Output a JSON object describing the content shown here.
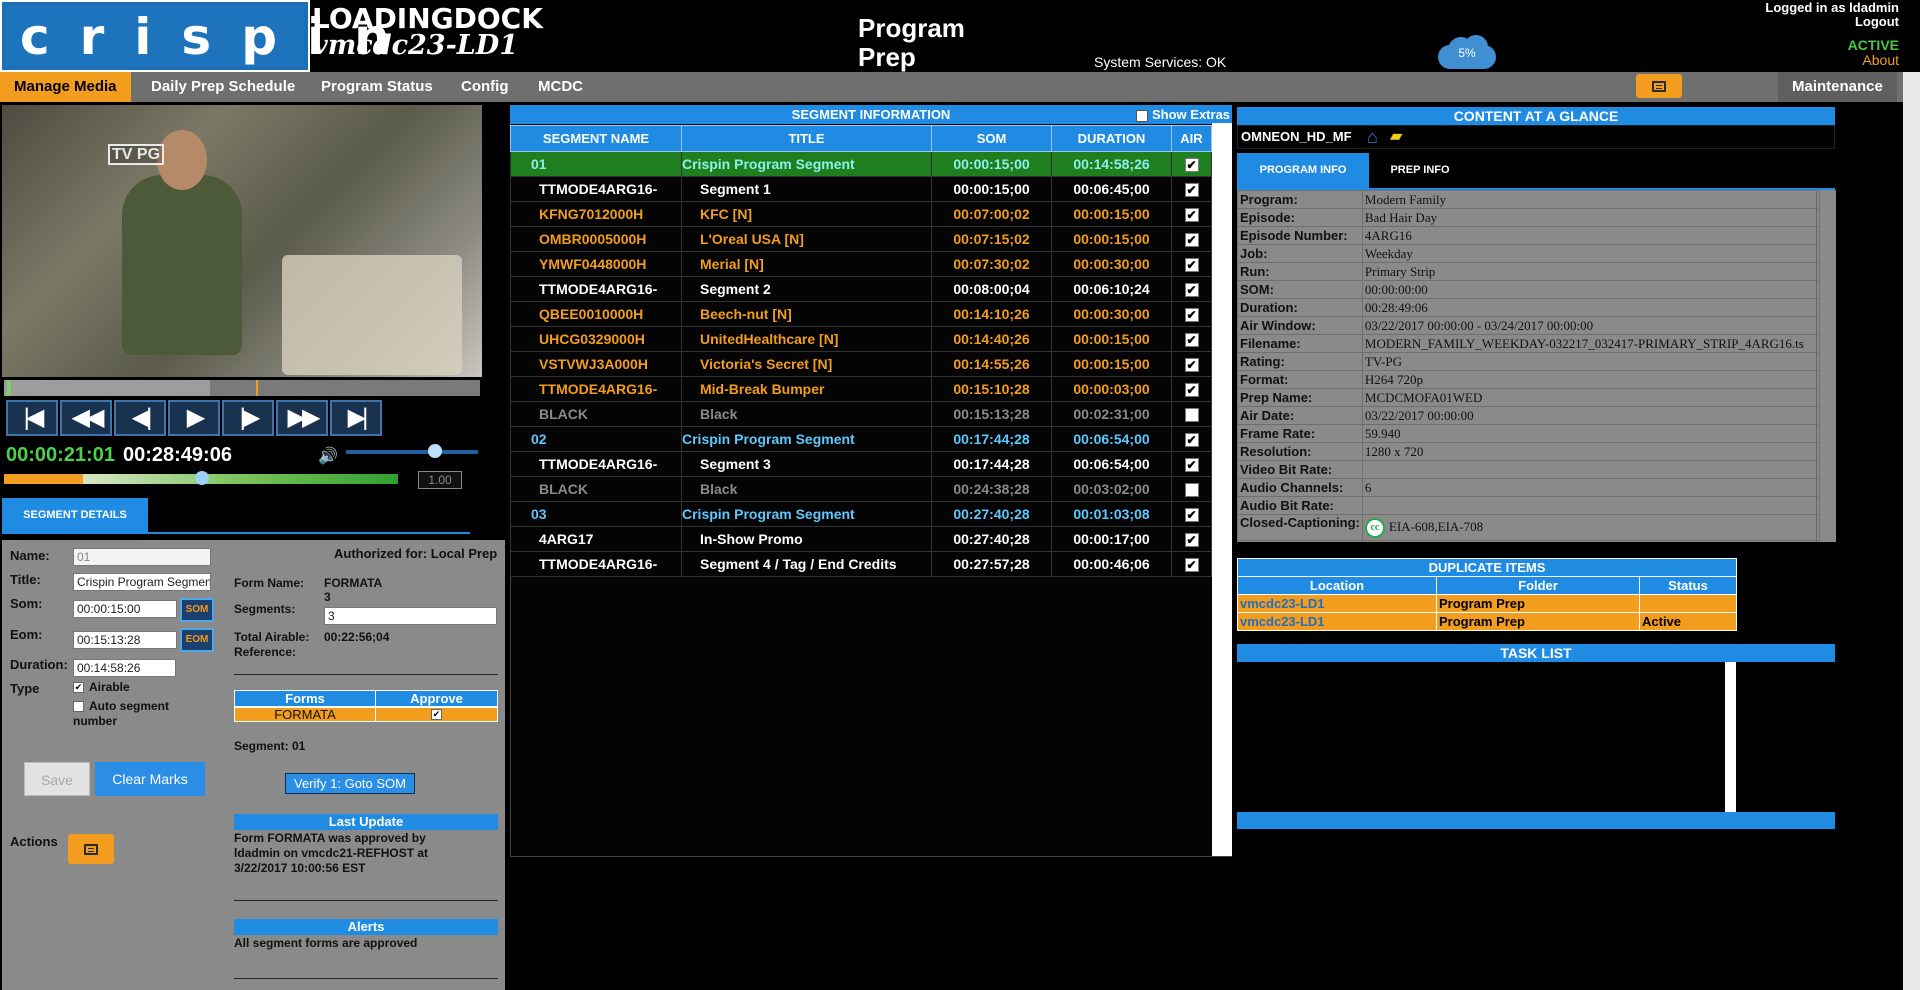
{
  "header": {
    "logo_text": "crispin",
    "station": "LOADINGDOCK",
    "host": "vmcdc23-LD1",
    "page_title": "Program Prep",
    "system_services": "System Services: OK",
    "storage_pct": "5%",
    "logged_in": "Logged in as ldadmin",
    "logout": "Logout",
    "status": "ACTIVE",
    "about": "About"
  },
  "nav": {
    "items": [
      "Manage Media",
      "Daily Prep Schedule",
      "Program Status",
      "Config",
      "MCDC"
    ],
    "maintenance": "Maintenance"
  },
  "player": {
    "rating": "TV PG",
    "current_tc": "00:00:21:01",
    "total_tc": "00:28:49:06",
    "speed": "1.00",
    "controls": [
      "|◀",
      "◀◀",
      "◀|",
      "▶",
      "|▶",
      "▶▶",
      "▶|"
    ]
  },
  "segment_details": {
    "tab": "SEGMENT DETAILS",
    "name_label": "Name:",
    "name_value": "01",
    "title_label": "Title:",
    "title_value": "Crispin Program Segment",
    "som_label": "Som:",
    "som_value": "00:00:15:00",
    "eom_label": "Eom:",
    "eom_value": "00:15:13:28",
    "duration_label": "Duration:",
    "duration_value": "00:14:58:26",
    "type_label": "Type",
    "airable_label": "Airable",
    "auto_seg_label": "Auto segment number",
    "som_btn": "SOM",
    "eom_btn": "EOM",
    "authorized": "Authorized for: Local Prep",
    "form_name_label": "Form Name:",
    "form_name_value": "FORMATA",
    "segments_label": "Segments:",
    "segments_value": "3",
    "segments_input": "3",
    "total_airable_label": "Total Airable:",
    "total_airable_value": "00:22:56;04",
    "reference_label": "Reference:",
    "forms_col": "Forms",
    "approve_col": "Approve",
    "form_row": "FORMATA",
    "segment_num": "Segment: 01",
    "verify_btn": "Verify 1: Goto SOM",
    "last_update_title": "Last Update",
    "last_update_text": "Form FORMATA was approved by ldadmin on vmcdc21-REFHOST at 3/22/2017 10:00:56 EST",
    "alerts_title": "Alerts",
    "alerts_text": "All segment forms are approved",
    "save": "Save",
    "clear_marks": "Clear Marks",
    "actions": "Actions"
  },
  "segment_info": {
    "title": "SEGMENT INFORMATION",
    "show_extras": "Show Extras",
    "columns": [
      "SEGMENT NAME",
      "TITLE",
      "SOM",
      "DURATION",
      "AIR"
    ],
    "rows": [
      {
        "name": "01",
        "title": "Crispin Program Segment",
        "som": "00:00:15;00",
        "dur": "00:14:58;26",
        "air": true,
        "kind": "sel"
      },
      {
        "name": "TTMODE4ARG16-",
        "title": "Segment 1",
        "som": "00:00:15;00",
        "dur": "00:06:45;00",
        "air": true,
        "kind": "white"
      },
      {
        "name": "KFNG7012000H",
        "title": "KFC [N]",
        "som": "00:07:00;02",
        "dur": "00:00:15;00",
        "air": true,
        "kind": "orange"
      },
      {
        "name": "OMBR0005000H",
        "title": "L'Oreal USA [N]",
        "som": "00:07:15;02",
        "dur": "00:00:15;00",
        "air": true,
        "kind": "orange"
      },
      {
        "name": "YMWF0448000H",
        "title": "Merial [N]",
        "som": "00:07:30;02",
        "dur": "00:00:30;00",
        "air": true,
        "kind": "orange"
      },
      {
        "name": "TTMODE4ARG16-",
        "title": "Segment 2",
        "som": "00:08:00;04",
        "dur": "00:06:10;24",
        "air": true,
        "kind": "white"
      },
      {
        "name": "QBEE0010000H",
        "title": "Beech-nut [N]",
        "som": "00:14:10;26",
        "dur": "00:00:30;00",
        "air": true,
        "kind": "orange"
      },
      {
        "name": "UHCG0329000H",
        "title": "UnitedHealthcare [N]",
        "som": "00:14:40;26",
        "dur": "00:00:15;00",
        "air": true,
        "kind": "orange"
      },
      {
        "name": "VSTVWJ3A000H",
        "title": "Victoria's Secret [N]",
        "som": "00:14:55;26",
        "dur": "00:00:15;00",
        "air": true,
        "kind": "orange"
      },
      {
        "name": "TTMODE4ARG16-",
        "title": "Mid-Break Bumper",
        "som": "00:15:10;28",
        "dur": "00:00:03;00",
        "air": true,
        "kind": "orange"
      },
      {
        "name": "BLACK",
        "title": "Black",
        "som": "00:15:13;28",
        "dur": "00:02:31;00",
        "air": false,
        "kind": "gray"
      },
      {
        "name": "02",
        "title": "Crispin Program Segment",
        "som": "00:17:44;28",
        "dur": "00:06:54;00",
        "air": true,
        "kind": "blue"
      },
      {
        "name": "TTMODE4ARG16-",
        "title": "Segment 3",
        "som": "00:17:44;28",
        "dur": "00:06:54;00",
        "air": true,
        "kind": "white"
      },
      {
        "name": "BLACK",
        "title": "Black",
        "som": "00:24:38;28",
        "dur": "00:03:02;00",
        "air": false,
        "kind": "gray"
      },
      {
        "name": "03",
        "title": "Crispin Program Segment",
        "som": "00:27:40;28",
        "dur": "00:01:03;08",
        "air": true,
        "kind": "blue"
      },
      {
        "name": "4ARG17",
        "title": "In-Show Promo",
        "som": "00:27:40;28",
        "dur": "00:00:17;00",
        "air": true,
        "kind": "white"
      },
      {
        "name": "TTMODE4ARG16-",
        "title": "Segment 4 / Tag / End Credits",
        "som": "00:27:57;28",
        "dur": "00:00:46;06",
        "air": true,
        "kind": "white"
      }
    ]
  },
  "content_glance": {
    "title": "CONTENT AT A GLANCE",
    "device": "OMNEON_HD_MF",
    "tab_program": "PROGRAM INFO",
    "tab_prep": "PREP INFO",
    "rows": [
      {
        "k": "Program:",
        "v": "Modern Family"
      },
      {
        "k": "Episode:",
        "v": "Bad Hair Day"
      },
      {
        "k": "Episode Number:",
        "v": "4ARG16"
      },
      {
        "k": "Job:",
        "v": "Weekday"
      },
      {
        "k": "Run:",
        "v": "Primary Strip"
      },
      {
        "k": "SOM:",
        "v": "00:00:00:00"
      },
      {
        "k": "Duration:",
        "v": "00:28:49:06"
      },
      {
        "k": "Air Window:",
        "v": "03/22/2017 00:00:00 - 03/24/2017 00:00:00"
      },
      {
        "k": "Filename:",
        "v": "MODERN_FAMILY_WEEKDAY-032217_032417-PRIMARY_STRIP_4ARG16.ts"
      },
      {
        "k": "Rating:",
        "v": "TV-PG"
      },
      {
        "k": "Format:",
        "v": "H264 720p"
      },
      {
        "k": "Prep Name:",
        "v": "MCDCMOFA01WED"
      },
      {
        "k": "Air Date:",
        "v": "03/22/2017 00:00:00"
      },
      {
        "k": "Frame Rate:",
        "v": "59.940"
      },
      {
        "k": "Resolution:",
        "v": "1280 x 720"
      },
      {
        "k": "Video Bit Rate:",
        "v": ""
      },
      {
        "k": "Audio Channels:",
        "v": "6"
      },
      {
        "k": "Audio Bit Rate:",
        "v": ""
      }
    ],
    "cc_label": "Closed-Captioning:",
    "cc_badge": "cc",
    "cc_value": "EIA-608,EIA-708"
  },
  "duplicates": {
    "title": "DUPLICATE ITEMS",
    "columns": [
      "Location",
      "Folder",
      "Status"
    ],
    "rows": [
      {
        "location": "vmcdc23-LD1",
        "folder": "Program Prep",
        "status": ""
      },
      {
        "location": "vmcdc23-LD1",
        "folder": "Program Prep",
        "status": "Active"
      }
    ]
  },
  "task_list": {
    "title": "TASK LIST"
  },
  "colors": {
    "accent_blue": "#1f8be2",
    "accent_orange": "#f39d1e",
    "selected_green": "#1f7f1f",
    "timecode_green": "#4ed14a"
  }
}
